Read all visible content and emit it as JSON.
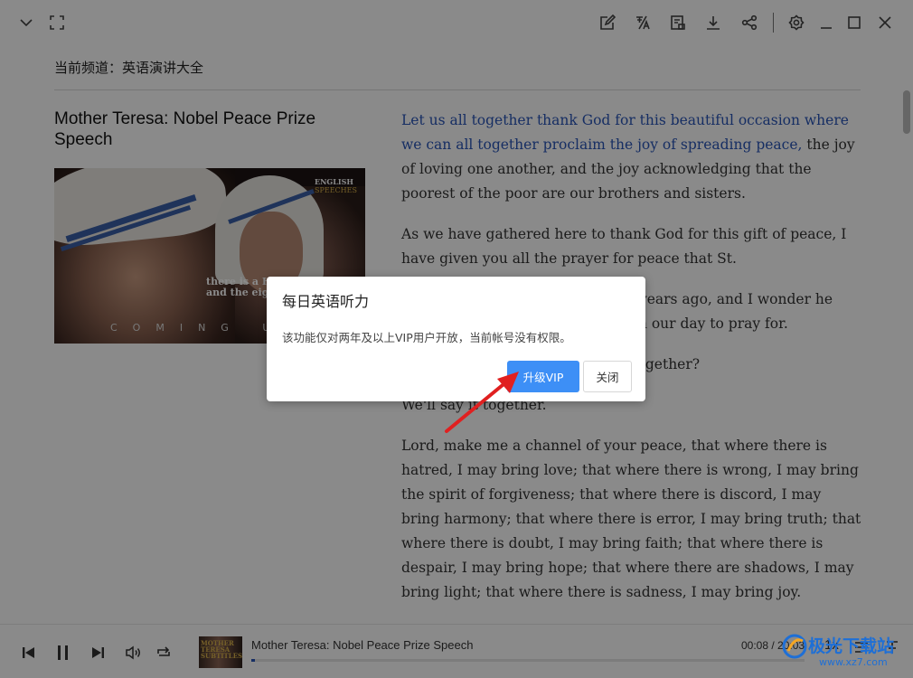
{
  "app": {
    "channel_label": "当前频道：英语演讲大全",
    "article_title": "Mother Teresa: Nobel Peace Prize Speech"
  },
  "thumbnail": {
    "brand_line1": "ENGLISH",
    "brand_line2": "SPEECHES",
    "caption_line1": "there is a H",
    "caption_line2": "and the eig",
    "coming": "COMING UP"
  },
  "content": {
    "p1_highlight": "Let us all together thank God for this beautiful occasion where we can all together proclaim the joy of spreading peace,",
    "p1_rest": " the joy of loving one another, and the joy acknowledging that the poorest of the poor are our brothers and sisters.",
    "p2": "As we have gathered here to thank God for this gift of peace, I have given you all the prayer for peace that St.",
    "p3": "Francis of Assisi prayed so many years ago, and I wonder he must have known what we need in our day to pray for.",
    "p4": "And so, shall we say this prayer together?",
    "p5": "We'll say it together.",
    "p6": "Lord, make me a channel of your peace, that where there is hatred, I may bring love; that where there is wrong, I may bring the spirit of forgiveness; that where there is discord, I may bring harmony; that where there is error, I may bring truth; that where there is doubt, I may bring faith; that where there is despair, I may bring hope; that where there are shadows, I may bring light; that where there is sadness, I may bring joy."
  },
  "player": {
    "track_title": "Mother Teresa: Nobel Peace Prize Speech",
    "time": "00:08 / 20:03",
    "speed": "1x",
    "progress_fraction": 0.007,
    "thumb_text": "MOTHER TERESA SUBTITLES"
  },
  "dialog": {
    "title": "每日英语听力",
    "message": "该功能仅对两年及以上VIP用户开放，当前帐号没有权限。",
    "upgrade_label": "升级VIP",
    "close_label": "关闭"
  },
  "watermark": {
    "name": "极光下载站",
    "url": "www.xz7.com"
  },
  "colors": {
    "accent": "#3d8ff6",
    "highlight_text": "#2a55b8",
    "overlay": "rgba(0,0,0,0.46)",
    "arrow": "#e02020"
  },
  "icons": {
    "titlebar": [
      "chevron-down-icon",
      "fullscreen-icon",
      "edit-icon",
      "translate-icon",
      "subtitle-icon",
      "download-icon",
      "share-icon",
      "settings-icon",
      "minimize-icon",
      "maximize-icon",
      "close-icon"
    ],
    "player": [
      "previous-icon",
      "pause-icon",
      "next-icon",
      "volume-icon",
      "repeat-icon",
      "playlist-icon",
      "text-icon"
    ]
  }
}
